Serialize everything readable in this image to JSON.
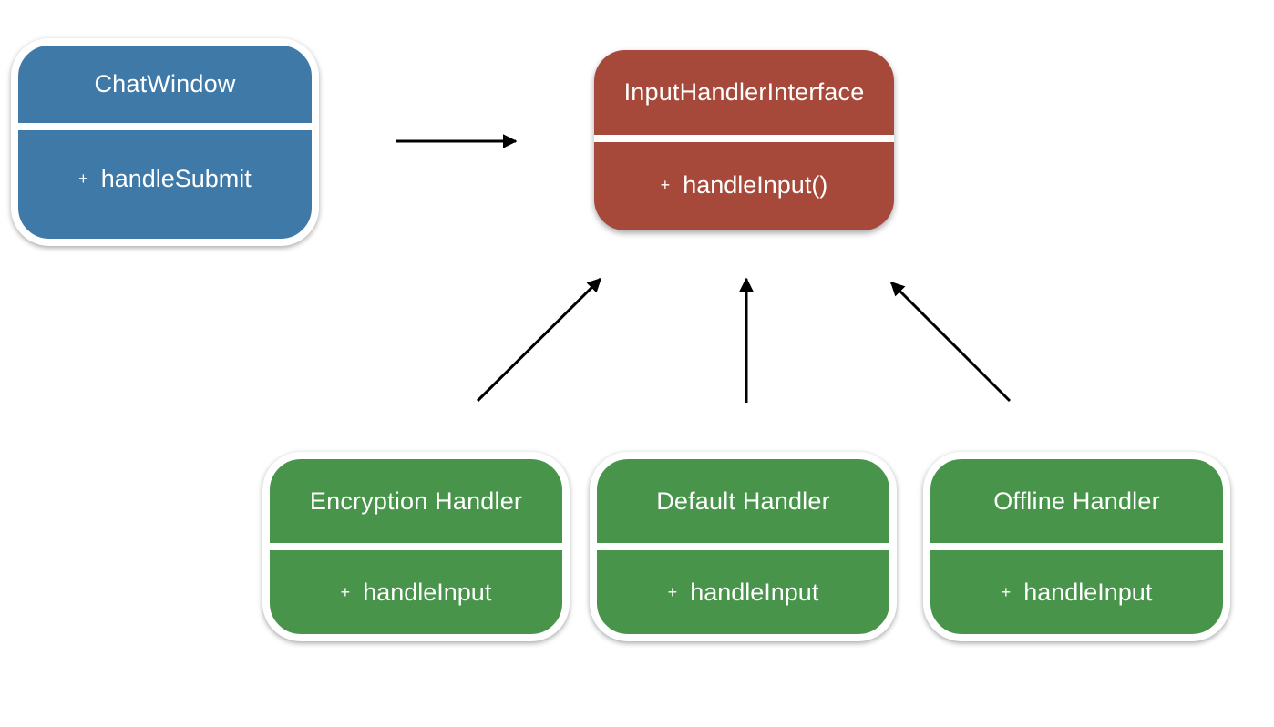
{
  "colors": {
    "client": "#3f79a8",
    "interface": "#a6483a",
    "implementation": "#47944a",
    "arrow": "#000000"
  },
  "nodes": {
    "chat_window": {
      "title": "ChatWindow",
      "member_prefix": "+",
      "member": "handleSubmit"
    },
    "input_handler_interface": {
      "title": "InputHandlerInterface",
      "member_prefix": "+",
      "member": "handleInput()"
    },
    "encryption_handler": {
      "title": "Encryption Handler",
      "member_prefix": "+",
      "member": "handleInput"
    },
    "default_handler": {
      "title": "Default Handler",
      "member_prefix": "+",
      "member": "handleInput"
    },
    "offline_handler": {
      "title": "Offline Handler",
      "member_prefix": "+",
      "member": "handleInput"
    }
  },
  "edges": [
    {
      "from": "chat_window",
      "to": "input_handler_interface",
      "type": "association"
    },
    {
      "from": "encryption_handler",
      "to": "input_handler_interface",
      "type": "implements"
    },
    {
      "from": "default_handler",
      "to": "input_handler_interface",
      "type": "implements"
    },
    {
      "from": "offline_handler",
      "to": "input_handler_interface",
      "type": "implements"
    }
  ]
}
